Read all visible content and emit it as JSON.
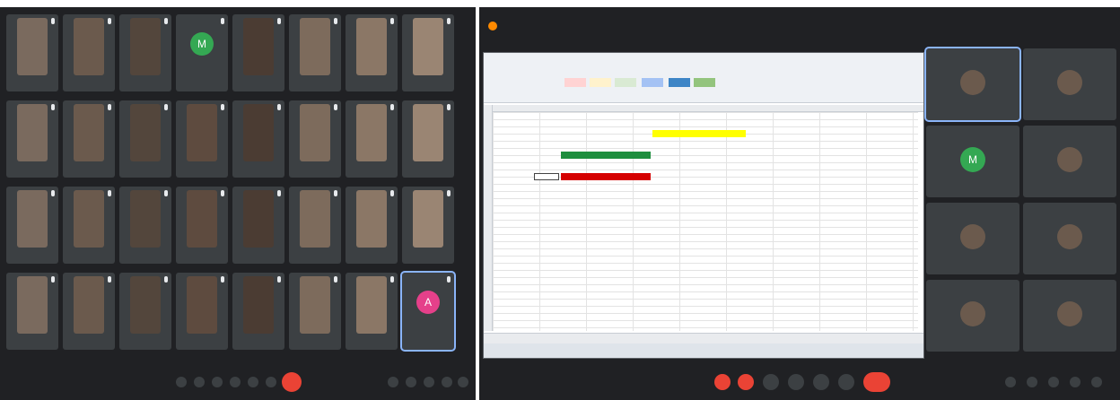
{
  "left": {
    "grid_names": [
      "",
      "",
      "",
      "",
      "",
      "",
      "",
      "",
      "",
      "",
      "",
      "",
      "",
      "",
      "",
      "",
      "",
      "",
      "",
      "",
      "",
      "",
      "",
      "",
      "",
      "",
      "",
      "",
      "",
      "",
      "",
      ""
    ],
    "avatar_letters": {
      "3": "M",
      "31": "A"
    },
    "meeting_id": "",
    "colors": {
      "avatar_green": "#34a853",
      "avatar_pink": "#e5408a",
      "hangup": "#ea4335",
      "self_border": "#8ab4f8"
    }
  },
  "right": {
    "title": "",
    "spreadsheet": {
      "highlight_yellow": "#ffff00",
      "bar_green": "#1e8e3e",
      "bar_red": "#d50000"
    },
    "side_tiles": [
      {
        "name": "",
        "letter": ""
      },
      {
        "name": "",
        "letter": ""
      },
      {
        "name": "",
        "letter": "M"
      },
      {
        "name": "",
        "letter": ""
      },
      {
        "name": "",
        "letter": ""
      },
      {
        "name": "",
        "letter": ""
      },
      {
        "name": "",
        "letter": ""
      },
      {
        "name": "",
        "letter": ""
      }
    ],
    "meeting_id": ""
  }
}
